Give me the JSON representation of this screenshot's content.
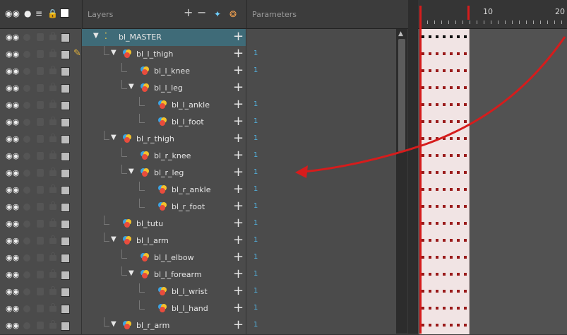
{
  "header": {
    "icons_label": "",
    "layers_title": "Layers",
    "parameters_title": "Parameters",
    "add_symbol": "+",
    "remove_symbol": "−"
  },
  "timeline": {
    "ruler_labels": [
      "10",
      "20"
    ]
  },
  "colors": {
    "selection": "#3f6b78",
    "param_value": "#53b2e0",
    "annotation_arrow": "#d61c1c"
  },
  "layers": [
    {
      "name": "bl_MASTER",
      "indent": 0,
      "twirl": "▼",
      "param": "",
      "selected": true,
      "peg": false
    },
    {
      "name": "bl_l_thigh",
      "indent": 1,
      "twirl": "▼",
      "param": "1",
      "pencil": true
    },
    {
      "name": "bl_l_knee",
      "indent": 2,
      "twirl": "",
      "param": "1"
    },
    {
      "name": "bl_l_leg",
      "indent": 2,
      "twirl": "▼",
      "param": ""
    },
    {
      "name": "bl_l_ankle",
      "indent": 3,
      "twirl": "",
      "param": "1"
    },
    {
      "name": "bl_l_foot",
      "indent": 3,
      "twirl": "",
      "param": "1"
    },
    {
      "name": "bl_r_thigh",
      "indent": 1,
      "twirl": "▼",
      "param": "1"
    },
    {
      "name": "bl_r_knee",
      "indent": 2,
      "twirl": "",
      "param": "1"
    },
    {
      "name": "bl_r_leg",
      "indent": 2,
      "twirl": "▼",
      "param": "1"
    },
    {
      "name": "bl_r_ankle",
      "indent": 3,
      "twirl": "",
      "param": "1"
    },
    {
      "name": "bl_r_foot",
      "indent": 3,
      "twirl": "",
      "param": "1"
    },
    {
      "name": "bl_tutu",
      "indent": 1,
      "twirl": "",
      "param": "1"
    },
    {
      "name": "bl_l_arm",
      "indent": 1,
      "twirl": "▼",
      "param": "1"
    },
    {
      "name": "bl_l_elbow",
      "indent": 2,
      "twirl": "",
      "param": "1"
    },
    {
      "name": "bl_l_forearm",
      "indent": 2,
      "twirl": "▼",
      "param": "1"
    },
    {
      "name": "bl_l_wrist",
      "indent": 3,
      "twirl": "",
      "param": "1"
    },
    {
      "name": "bl_l_hand",
      "indent": 3,
      "twirl": "",
      "param": "1"
    },
    {
      "name": "bl_r_arm",
      "indent": 1,
      "twirl": "▼",
      "param": "1"
    }
  ]
}
